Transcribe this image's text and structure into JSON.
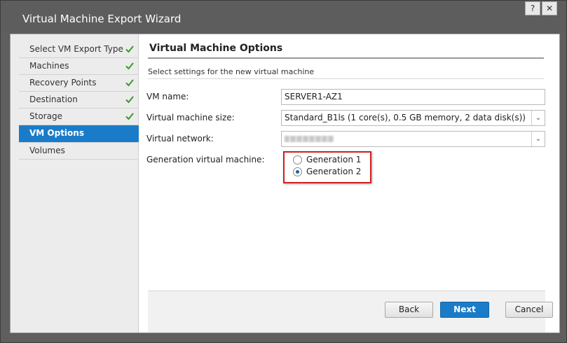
{
  "window": {
    "title": "Virtual Machine Export Wizard",
    "help_label": "?",
    "close_label": "✕"
  },
  "sidebar": {
    "items": [
      {
        "label": "Select VM Export Type",
        "completed": true
      },
      {
        "label": "Machines",
        "completed": true
      },
      {
        "label": "Recovery Points",
        "completed": true
      },
      {
        "label": "Destination",
        "completed": true
      },
      {
        "label": "Storage",
        "completed": true
      },
      {
        "label": "VM Options",
        "completed": false,
        "active": true
      },
      {
        "label": "Volumes",
        "completed": false
      }
    ]
  },
  "main": {
    "title": "Virtual Machine Options",
    "subtitle": "Select settings for the new virtual machine",
    "vm_name_label": "VM name:",
    "vm_name_value": "SERVER1-AZ1",
    "vm_size_label": "Virtual machine size:",
    "vm_size_value": "Standard_B1ls (1 core(s), 0.5 GB memory, 2 data disk(s))",
    "network_label": "Virtual network:",
    "generation_label": "Generation virtual machine:",
    "generation_options": [
      {
        "label": "Generation 1",
        "selected": false
      },
      {
        "label": "Generation 2",
        "selected": true
      }
    ]
  },
  "buttons": {
    "back": "Back",
    "next": "Next",
    "cancel": "Cancel"
  },
  "colors": {
    "accent": "#1a7cc9",
    "highlight": "#d11f1f",
    "check": "#3a9a2a"
  },
  "icons": {
    "check": "check-icon",
    "dropdown": "chevron-down-icon"
  }
}
